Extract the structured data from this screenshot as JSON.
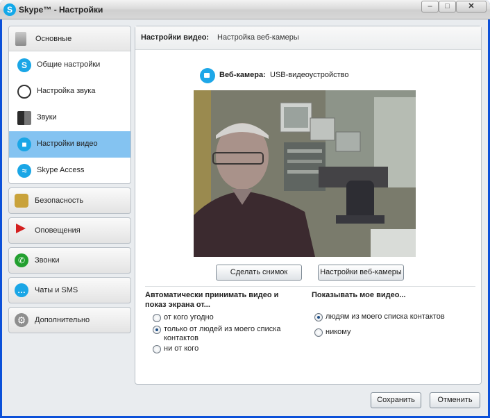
{
  "window": {
    "title": "Skype™ - Настройки",
    "logo_letter": "S",
    "controls": {
      "minimize": "–",
      "maximize": "□",
      "close": "✕"
    }
  },
  "sidebar": {
    "primary": {
      "header": {
        "label": "Основные",
        "icon": "phone-handset-icon"
      },
      "items": [
        {
          "label": "Общие настройки",
          "icon": "skype-icon"
        },
        {
          "label": "Настройка звука",
          "icon": "microphone-icon"
        },
        {
          "label": "Звуки",
          "icon": "speaker-icon"
        },
        {
          "label": "Настройки видео",
          "icon": "webcam-icon",
          "selected": true
        },
        {
          "label": "Skype Access",
          "icon": "wifi-icon"
        }
      ]
    },
    "sections": [
      {
        "label": "Безопасность",
        "icon": "key-lock-icon"
      },
      {
        "label": "Оповещения",
        "icon": "red-flag-icon"
      },
      {
        "label": "Звонки",
        "icon": "phone-call-icon"
      },
      {
        "label": "Чаты и SMS",
        "icon": "chat-bubble-icon"
      },
      {
        "label": "Дополнительно",
        "icon": "gear-icon"
      }
    ]
  },
  "panel": {
    "title": "Настройки видео:",
    "subtitle": "Настройка веб-камеры",
    "webcam": {
      "label": "Веб-камера:",
      "value": "USB-видеоустройство"
    },
    "buttons": {
      "snapshot": "Сделать снимок",
      "webcam_settings": "Настройки веб-камеры"
    },
    "auto_accept": {
      "title": "Автоматически принимать видео и показ экрана от...",
      "options": [
        {
          "label": "от кого угодно",
          "checked": false
        },
        {
          "label": "только от людей из моего списка контактов",
          "checked": true
        },
        {
          "label": "ни от кого",
          "checked": false
        }
      ]
    },
    "show_my_video": {
      "title": "Показывать мое видео...",
      "options": [
        {
          "label": "людям из моего списка контактов",
          "checked": true
        },
        {
          "label": "никому",
          "checked": false
        }
      ]
    }
  },
  "footer": {
    "save": "Сохранить",
    "cancel": "Отменить"
  },
  "colors": {
    "selected_bg": "#84c3f1",
    "accent": "#1aa6e6",
    "window_frame": "#0b50d9"
  }
}
